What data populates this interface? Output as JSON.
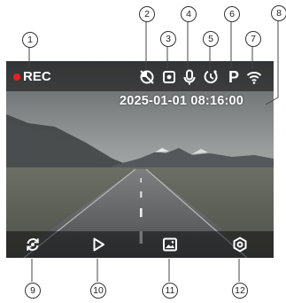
{
  "status_bar": {
    "rec_label": "REC",
    "rec_color": "#e8211f",
    "icons": [
      "motion-detection-off-icon",
      "camera-sensor-icon",
      "microphone-icon",
      "gps-timer-icon",
      "parking-mode-icon",
      "wifi-icon"
    ]
  },
  "datetime": "2025-01-01 08:16:00",
  "bottom_bar": {
    "icons": [
      "switch-camera-icon",
      "play-icon",
      "gallery-icon",
      "settings-icon"
    ]
  },
  "callouts": [
    "1",
    "2",
    "3",
    "4",
    "5",
    "6",
    "7",
    "8",
    "9",
    "10",
    "11",
    "12"
  ],
  "parking_glyph": "P"
}
